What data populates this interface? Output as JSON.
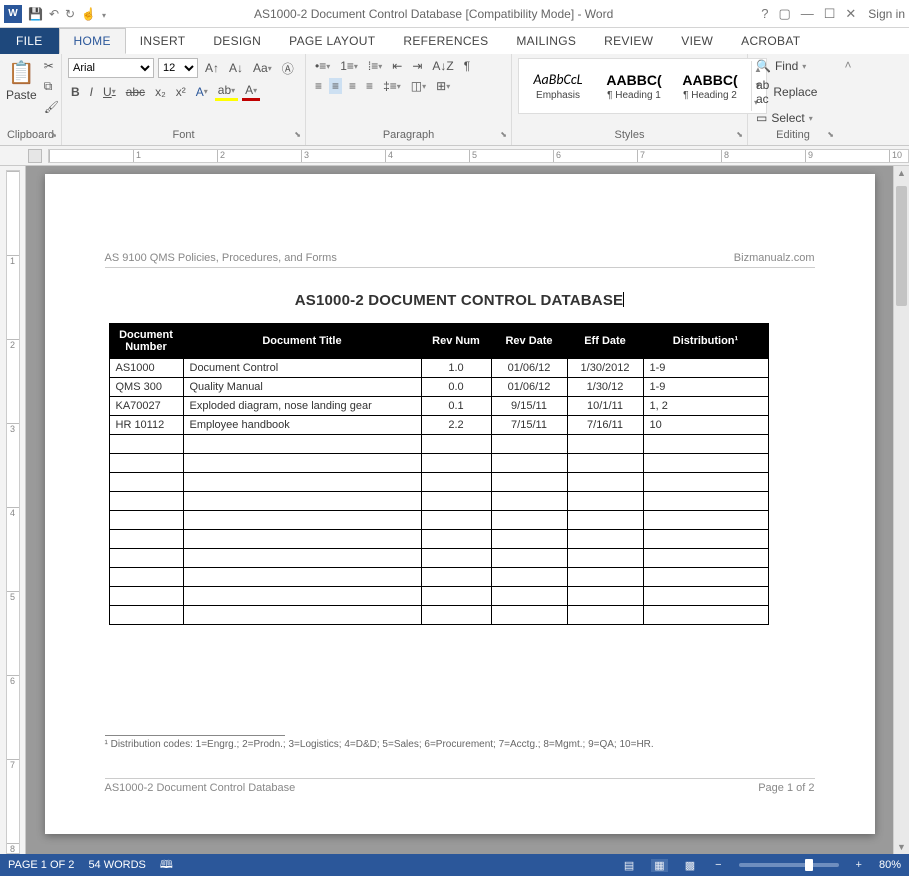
{
  "titlebar": {
    "title": "AS1000-2 Document Control Database [Compatibility Mode] - Word",
    "sign_in": "Sign in"
  },
  "tabs": {
    "file": "FILE",
    "home": "HOME",
    "insert": "INSERT",
    "design": "DESIGN",
    "page_layout": "PAGE LAYOUT",
    "references": "REFERENCES",
    "mailings": "MAILINGS",
    "review": "REVIEW",
    "view": "VIEW",
    "acrobat": "ACROBAT"
  },
  "ribbon": {
    "clipboard": {
      "label": "Clipboard",
      "paste": "Paste"
    },
    "font": {
      "label": "Font",
      "family": "Arial",
      "size": "12"
    },
    "paragraph": {
      "label": "Paragraph"
    },
    "styles": {
      "label": "Styles",
      "items": [
        {
          "preview": "AaBbCcL",
          "name": "Emphasis"
        },
        {
          "preview": "AABBC(",
          "name": "¶ Heading 1"
        },
        {
          "preview": "AABBC(",
          "name": "¶ Heading 2"
        }
      ]
    },
    "editing": {
      "label": "Editing",
      "find": "Find",
      "replace": "Replace",
      "select": "Select"
    }
  },
  "document": {
    "header_left": "AS 9100 QMS Policies, Procedures, and Forms",
    "header_right": "Bizmanualz.com",
    "title": "AS1000-2 DOCUMENT CONTROL DATABASE",
    "columns": {
      "doc_num": "Document Number",
      "doc_title": "Document Title",
      "rev_num": "Rev Num",
      "rev_date": "Rev Date",
      "eff_date": "Eff Date",
      "distribution": "Distribution¹"
    },
    "rows": [
      {
        "num": "AS1000",
        "title": "Document Control",
        "rev": "1.0",
        "rdate": "01/06/12",
        "edate": "1/30/2012",
        "dist": "1-9"
      },
      {
        "num": "QMS 300",
        "title": "Quality Manual",
        "rev": "0.0",
        "rdate": "01/06/12",
        "edate": "1/30/12",
        "dist": "1-9"
      },
      {
        "num": "KA70027",
        "title": "Exploded diagram, nose landing gear",
        "rev": "0.1",
        "rdate": "9/15/11",
        "edate": "10/1/11",
        "dist": "1, 2"
      },
      {
        "num": "HR 10112",
        "title": "Employee handbook",
        "rev": "2.2",
        "rdate": "7/15/11",
        "edate": "7/16/11",
        "dist": "10"
      }
    ],
    "empty_rows": 10,
    "footnote": "¹ Distribution codes: 1=Engrg.; 2=Prodn.; 3=Logistics; 4=D&D; 5=Sales; 6=Procurement; 7=Acctg.; 8=Mgmt.; 9=QA; 10=HR.",
    "footer_left": "AS1000-2 Document Control Database",
    "footer_right": "Page 1 of 2"
  },
  "statusbar": {
    "page": "PAGE 1 OF 2",
    "words": "54 WORDS",
    "zoom": "80%"
  }
}
